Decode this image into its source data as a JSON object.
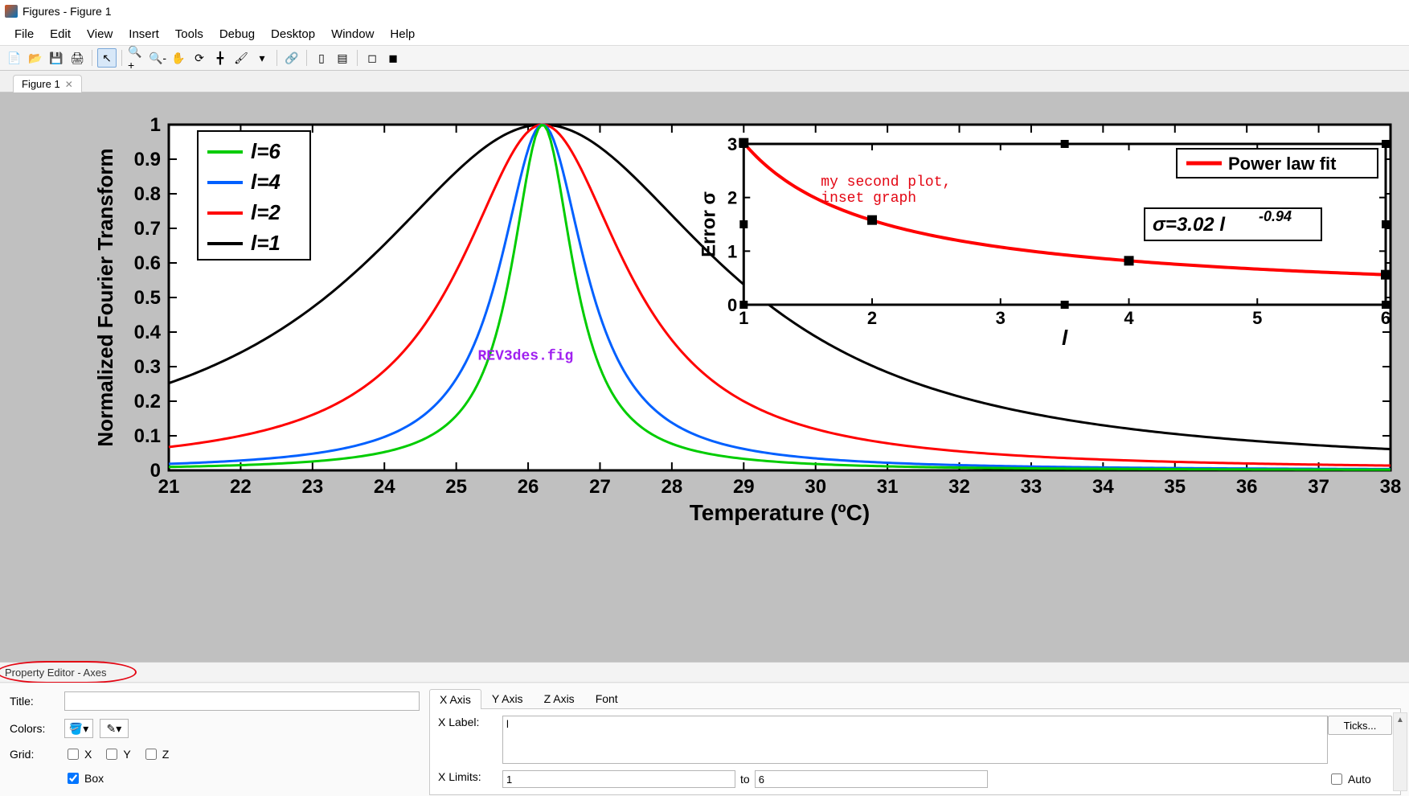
{
  "window": {
    "title": "Figures - Figure 1"
  },
  "menubar": {
    "items": [
      "File",
      "Edit",
      "View",
      "Insert",
      "Tools",
      "Debug",
      "Desktop",
      "Window",
      "Help"
    ]
  },
  "toolbar": {
    "buttons": [
      {
        "name": "new-figure-icon",
        "glyph": "📄"
      },
      {
        "name": "open-icon",
        "glyph": "📂"
      },
      {
        "name": "save-icon",
        "glyph": "💾"
      },
      {
        "name": "print-icon",
        "glyph": "🖨"
      },
      {
        "sep": true
      },
      {
        "name": "edit-plot-icon",
        "glyph": "↖",
        "selected": true
      },
      {
        "sep": true
      },
      {
        "name": "zoom-in-icon",
        "glyph": "🔍+"
      },
      {
        "name": "zoom-out-icon",
        "glyph": "🔍-"
      },
      {
        "name": "pan-icon",
        "glyph": "✋"
      },
      {
        "name": "rotate3d-icon",
        "glyph": "⟳"
      },
      {
        "name": "data-cursor-icon",
        "glyph": "╋"
      },
      {
        "name": "brush-icon",
        "glyph": "🖌"
      },
      {
        "name": "brush-dropdown-icon",
        "glyph": "▾"
      },
      {
        "sep": true
      },
      {
        "name": "link-axes-icon",
        "glyph": "🔗"
      },
      {
        "sep": true
      },
      {
        "name": "insert-colorbar-icon",
        "glyph": "▯"
      },
      {
        "name": "insert-legend-icon",
        "glyph": "▤"
      },
      {
        "sep": true
      },
      {
        "name": "hide-tools-icon",
        "glyph": "◻"
      },
      {
        "name": "show-tools-icon",
        "glyph": "◼"
      }
    ]
  },
  "doctabs": {
    "tab0": "Figure 1"
  },
  "chart_data": [
    {
      "type": "line",
      "title": "",
      "xlabel": "Temperature (ºC)",
      "ylabel": "Normalized Fourier Transform",
      "xlim": [
        21,
        38
      ],
      "ylim": [
        0,
        1
      ],
      "xticks": [
        21,
        22,
        23,
        24,
        25,
        26,
        27,
        28,
        29,
        30,
        31,
        32,
        33,
        34,
        35,
        36,
        37,
        38
      ],
      "yticks": [
        0,
        0.1,
        0.2,
        0.3,
        0.4,
        0.5,
        0.6,
        0.7,
        0.8,
        0.9,
        1
      ],
      "legend": {
        "position": "upper-left",
        "entries": [
          "l=6",
          "l=4",
          "l=2",
          "l=1"
        ]
      },
      "center": 26.2,
      "sigma": {
        "l=6": 0.52,
        "l=4": 0.72,
        "l=2": 1.4,
        "l=1": 3.02
      },
      "colors": {
        "l=6": "#00cc00",
        "l=4": "#0060ff",
        "l=2": "#ff0000",
        "l=1": "#000000"
      },
      "annotations": [
        {
          "text": "REV3des.fig",
          "kind": "filename"
        },
        {
          "text": "my second plot,",
          "kind": "user"
        },
        {
          "text": "inset graph",
          "kind": "user"
        }
      ]
    },
    {
      "type": "line",
      "title": "",
      "xlabel": "l",
      "ylabel": "Error σ",
      "xlim": [
        1,
        6
      ],
      "ylim": [
        0,
        3
      ],
      "xticks": [
        1,
        2,
        3,
        4,
        5,
        6
      ],
      "yticks": [
        0,
        1,
        2,
        3
      ],
      "legend": {
        "position": "upper-right",
        "entries": [
          "Power law fit"
        ]
      },
      "series": [
        {
          "name": "Power law fit",
          "color": "#ff0000",
          "x": [
            1,
            2,
            4,
            6
          ],
          "y": [
            3.02,
            1.58,
            0.82,
            0.56
          ]
        }
      ],
      "formula": "σ=3.02 l^{-0.94}"
    }
  ],
  "page_annotations": {
    "filename": "REV3des.fig",
    "inset_note_line1": "my second plot,",
    "inset_note_line2": "inset graph"
  },
  "prop_editor": {
    "header": "Property Editor - Axes",
    "left": {
      "title_label": "Title:",
      "title_value": "",
      "colors_label": "Colors:",
      "grid_label": "Grid:",
      "grid_x": "X",
      "grid_y": "Y",
      "grid_z": "Z",
      "box_label": "Box"
    },
    "right": {
      "tabs": [
        "X Axis",
        "Y Axis",
        "Z Axis",
        "Font"
      ],
      "active_tab": 0,
      "xlabel_label": "X Label:",
      "xlabel_value": "l",
      "xlimits_label": "X Limits:",
      "xlimits_from": "1",
      "xlimits_to_label": "to",
      "xlimits_to": "6",
      "ticks_btn": "Ticks...",
      "auto_label": "Auto"
    }
  }
}
